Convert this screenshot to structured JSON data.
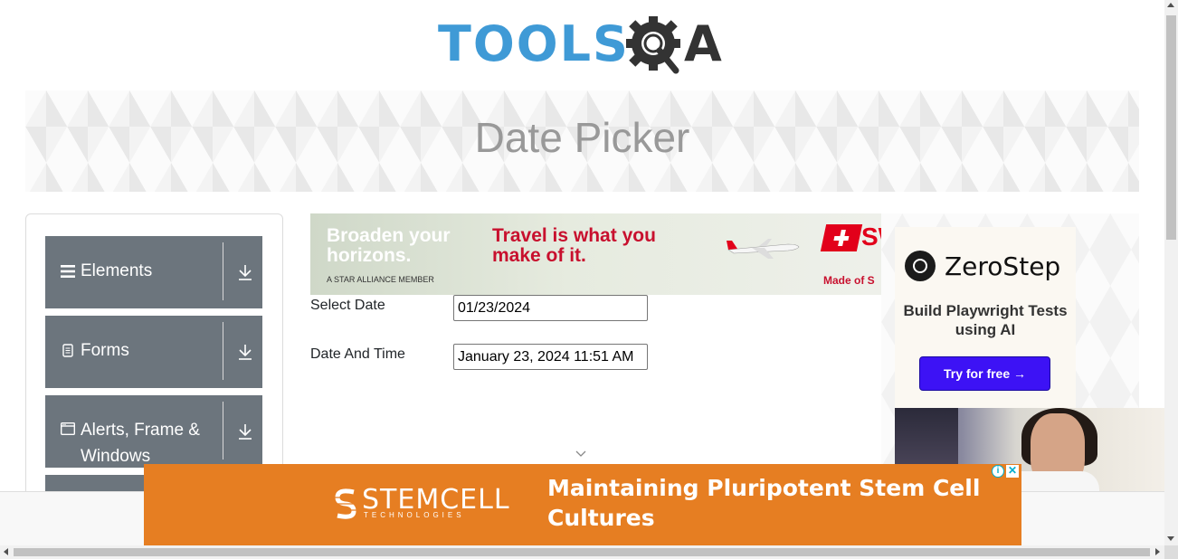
{
  "header": {
    "logo_text_left": "TOOLS",
    "logo_text_right": "A"
  },
  "banner": {
    "title": "Date Picker"
  },
  "sidebar": {
    "groups": [
      {
        "label": "Elements",
        "icon": "menu-icon"
      },
      {
        "label": "Forms",
        "icon": "document-icon"
      },
      {
        "label": "Alerts, Frame & Windows",
        "icon": "window-icon"
      }
    ]
  },
  "top_ad": {
    "headline_left": "Broaden your horizons.",
    "tagline": "A STAR ALLIANCE MEMBER",
    "headline_right": "Travel is what you make of it.",
    "brand_partial": "SW",
    "footer_partial": "Made of S"
  },
  "form": {
    "select_date_label": "Select Date",
    "select_date_value": "01/23/2024",
    "date_time_label": "Date And Time",
    "date_time_value": "January 23, 2024 11:51 AM"
  },
  "right_ad": {
    "brand": "ZeroStep",
    "tagline": "Build Playwright Tests using AI",
    "cta": "Try for free →"
  },
  "bottom_ad": {
    "brand": "STEMCELL",
    "brand_sub": "TECHNOLOGIES",
    "headline": "Maintaining Pluripotent Stem Cell Cultures",
    "info_glyph": "i",
    "close_glyph": "✕"
  },
  "colors": {
    "sidebar_group_bg": "#6c757d",
    "logo_blue": "#3f9ad6",
    "stemcell_orange": "#e67e22",
    "zerostep_button": "#3d12f5",
    "swiss_red": "#e2001a"
  }
}
